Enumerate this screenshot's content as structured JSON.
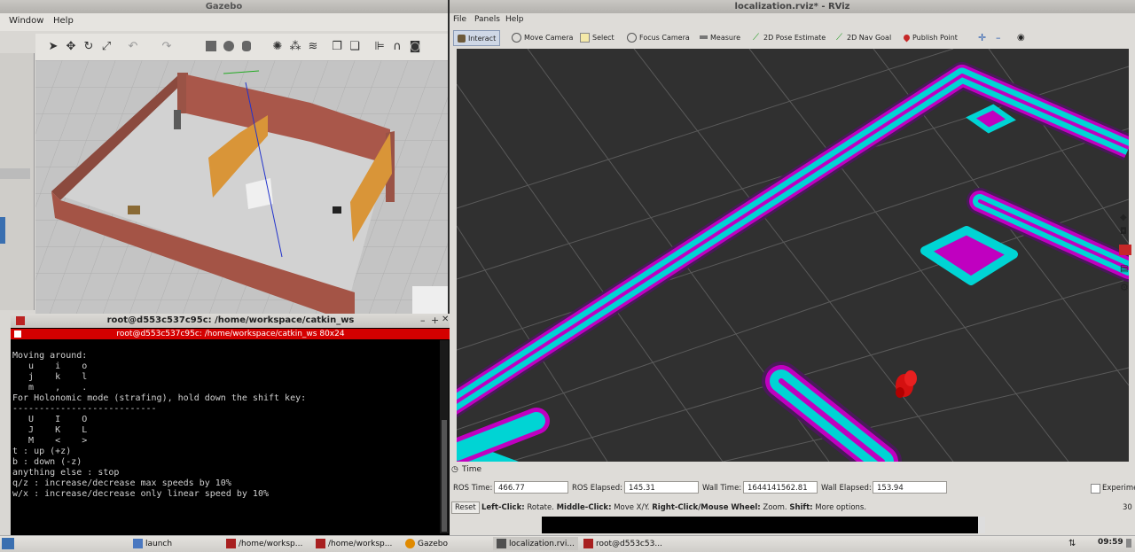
{
  "gazebo": {
    "title": "Gazebo",
    "menus": [
      "Window",
      "Help"
    ]
  },
  "terminal": {
    "title": "root@d553c537c95c: /home/workspace/catkin_ws",
    "tab": "root@d553c537c95c: /home/workspace/catkin_ws 80x24",
    "lines": [
      "Moving around:",
      "   u    i    o",
      "   j    k    l",
      "   m    ,    .",
      "",
      "For Holonomic mode (strafing), hold down the shift key:",
      "---------------------------",
      "   U    I    O",
      "   J    K    L",
      "   M    <    >",
      "",
      "t : up (+z)",
      "b : down (-z)",
      "",
      "anything else : stop",
      "",
      "q/z : increase/decrease max speeds by 10%",
      "w/x : increase/decrease only linear speed by 10%"
    ]
  },
  "rviz": {
    "title": "localization.rviz* - RViz",
    "menus": [
      "File",
      "Panels",
      "Help"
    ],
    "tools": [
      "Interact",
      "Move Camera",
      "Select",
      "Focus Camera",
      "Measure",
      "2D Pose Estimate",
      "2D Nav Goal",
      "Publish Point"
    ],
    "time_panel": {
      "header": "Time",
      "ros_time_label": "ROS Time:",
      "ros_time": "466.77",
      "ros_elapsed_label": "ROS Elapsed:",
      "ros_elapsed": "145.31",
      "wall_time_label": "Wall Time:",
      "wall_time": "1644141562.81",
      "wall_elapsed_label": "Wall Elapsed:",
      "wall_elapsed": "153.94",
      "experimental_label": "Experime",
      "reset_label": "Reset",
      "fps": "30"
    },
    "hint": {
      "left_click_label": "Left-Click:",
      "left_click": "Rotate.",
      "middle_click_label": "Middle-Click:",
      "middle_click": "Move X/Y.",
      "right_click_label": "Right-Click/Mouse Wheel:",
      "right_click": "Zoom.",
      "shift_label": "Shift:",
      "shift": "More options."
    }
  },
  "taskbar": {
    "items": [
      "launch",
      "/home/worksp...",
      "/home/worksp...",
      "Gazebo",
      "localization.rvi...",
      "root@d553c53..."
    ],
    "clock": "09:59"
  },
  "colors": {
    "cyan": "#00d4d4",
    "magenta": "#c000c0",
    "terminal_tab": "#d40000"
  }
}
